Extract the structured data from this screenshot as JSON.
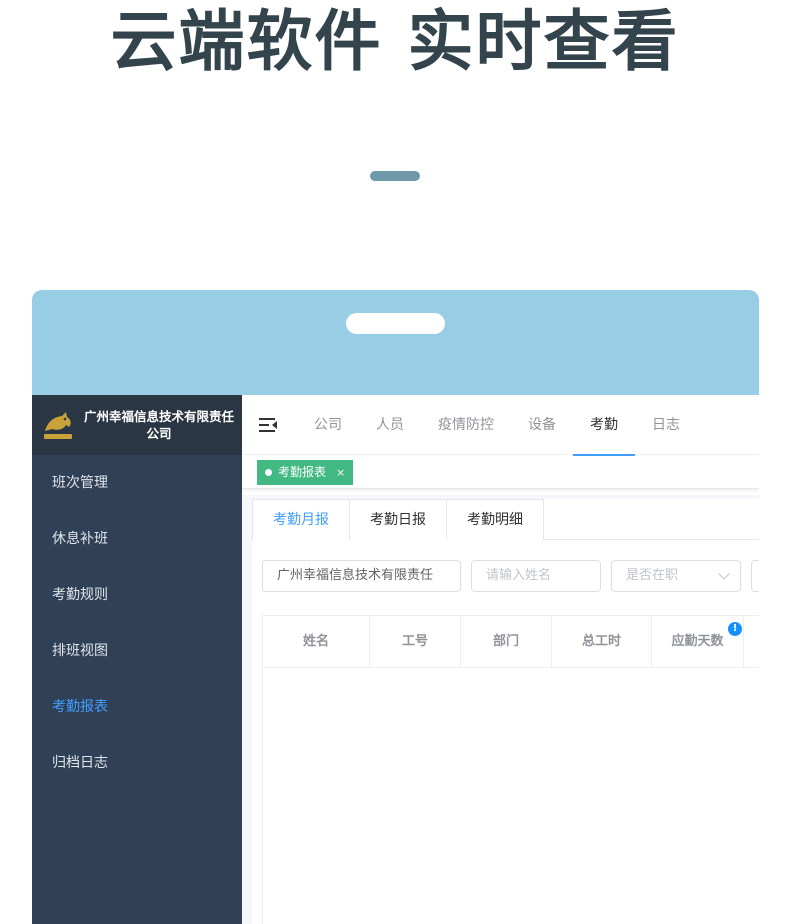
{
  "hero": {
    "title": "云端软件 实时查看"
  },
  "colors": {
    "sidebar_bg": "#304157",
    "brand_bg": "#2b3644",
    "accent": "#409eff",
    "tag_green": "#42b983",
    "device_frame": "#98cde6",
    "title_color": "#34444d"
  },
  "sidebar": {
    "logo_icon": "horse-logo-icon",
    "brand_name": "广州幸福信息技术有限责任公司",
    "items": [
      {
        "label": "班次管理"
      },
      {
        "label": "休息补班"
      },
      {
        "label": "考勤规则"
      },
      {
        "label": "排班视图"
      },
      {
        "label": "考勤报表",
        "active": true
      },
      {
        "label": "归档日志"
      }
    ]
  },
  "topnav": {
    "toggle_icon": "menu-fold-icon",
    "items": [
      {
        "label": "公司"
      },
      {
        "label": "人员"
      },
      {
        "label": "疫情防控"
      },
      {
        "label": "设备"
      },
      {
        "label": "考勤",
        "active": true
      },
      {
        "label": "日志"
      }
    ]
  },
  "tags": [
    {
      "label": "考勤报表",
      "close": "×",
      "active": true
    }
  ],
  "report_tabs": [
    {
      "label": "考勤月报",
      "active": true
    },
    {
      "label": "考勤日报"
    },
    {
      "label": "考勤明细"
    }
  ],
  "filters": {
    "company": {
      "value": "广州幸福信息技术有限责任"
    },
    "name": {
      "placeholder": "请输入姓名"
    },
    "status": {
      "placeholder": "是否在职"
    }
  },
  "table": {
    "columns": [
      "姓名",
      "工号",
      "部门",
      "总工时",
      "应勤天数"
    ],
    "info_badge": "!",
    "rows": []
  }
}
